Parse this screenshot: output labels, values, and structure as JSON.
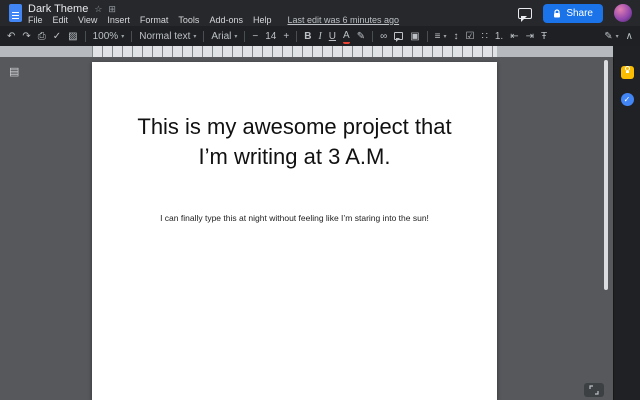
{
  "topbar": {
    "doc_title": "Dark Theme",
    "menus": [
      "File",
      "Edit",
      "View",
      "Insert",
      "Format",
      "Tools",
      "Add-ons",
      "Help"
    ],
    "last_edit": "Last edit was 6 minutes ago",
    "share_label": "Share",
    "icons": {
      "star": "☆",
      "move": "⊞"
    }
  },
  "toolbar": {
    "zoom": "100%",
    "styles": "Normal text",
    "font": "Arial",
    "font_size": "14",
    "icons": {
      "undo": "↶",
      "redo": "↷",
      "print": "⎙",
      "spellcheck": "✓",
      "paint_format": "▨",
      "dropdown": "▾",
      "minus": "−",
      "plus": "+",
      "bold": "B",
      "italic": "I",
      "underline": "U",
      "text_color": "A",
      "highlight": "✎",
      "link": "∞",
      "image": "▣",
      "align": "≡",
      "line_spacing": "↕",
      "checklist": "☑",
      "bulleted_list": "∷",
      "numbered_list": "1.",
      "indent_decrease": "⇤",
      "indent_increase": "⇥",
      "clear_formatting": "Ŧ",
      "editing_mode": "✎",
      "collapse": "∧"
    }
  },
  "left_rail": {
    "outline_icon": "▤"
  },
  "side_panel": {
    "tasks_check": "✓"
  },
  "document": {
    "heading": "This is my awesome project that I’m writing at 3 A.M.",
    "body": "I can finally type this at night without feeling like I’m staring into the sun!"
  },
  "colors": {
    "accent_blue": "#1a73e8",
    "keep_yellow": "#fbbc04",
    "tasks_blue": "#4285f4",
    "page": "#ffffff",
    "topbar": "#26282b",
    "canvas": "#56585c"
  }
}
